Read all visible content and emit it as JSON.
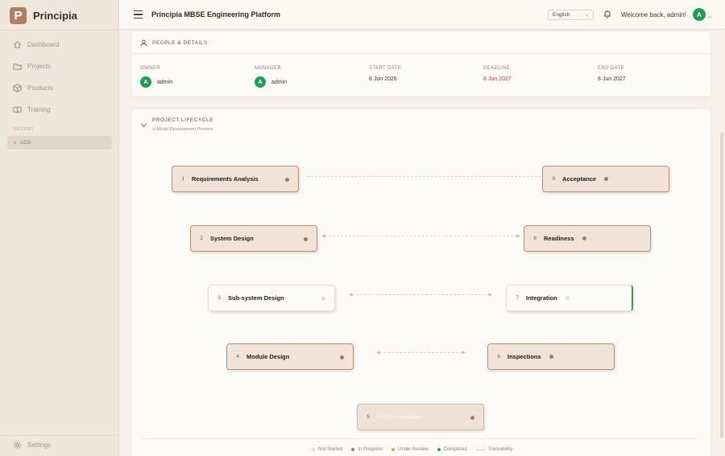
{
  "brand": {
    "logo_letter": "P",
    "name": "Principia"
  },
  "sidebar": {
    "items": [
      {
        "label": "Dashboard",
        "icon": "home-icon"
      },
      {
        "label": "Projects",
        "icon": "folder-icon"
      },
      {
        "label": "Products",
        "icon": "box-icon"
      },
      {
        "label": "Training",
        "icon": "book-icon"
      }
    ],
    "recent_label": "RECENT",
    "recent_items": [
      "ADS"
    ],
    "settings_label": "Settings"
  },
  "header": {
    "title": "Principia MBSE Engineering Platform",
    "language": "English",
    "welcome": "Welcome back, admin!",
    "avatar_letter": "A"
  },
  "people": {
    "title": "PEOPLE & DETAILS",
    "fields": [
      {
        "label": "OWNER",
        "value": "admin",
        "avatar": "A"
      },
      {
        "label": "MANAGER",
        "value": "admin",
        "avatar": "A"
      },
      {
        "label": "START DATE",
        "value": "8 Jun 2026"
      },
      {
        "label": "DEADLINE",
        "value": "8 Jun 2027",
        "color": "#b8432e"
      },
      {
        "label": "END DATE",
        "value": "8 Jun 2027"
      }
    ]
  },
  "lifecycle": {
    "title": "PROJECT LIFECYCLE",
    "subtitle": "V-Model Development Process",
    "nodes": [
      {
        "num": "1",
        "label": "Requirements Analysis"
      },
      {
        "num": "2",
        "label": "System Design"
      },
      {
        "num": "3",
        "label": "Sub-system Design"
      },
      {
        "num": "4",
        "label": "Module Design"
      },
      {
        "num": "5",
        "label": "Implementation"
      },
      {
        "num": "6",
        "label": "Inspections"
      },
      {
        "num": "7",
        "label": "Integration"
      },
      {
        "num": "8",
        "label": "Readiness"
      },
      {
        "num": "9",
        "label": "Acceptance"
      }
    ],
    "legend": [
      "Not Started",
      "In Progress",
      "Under Review",
      "Completed",
      "Traceability"
    ]
  },
  "colors": {
    "accent": "#b07f5f",
    "avatar_green": "#1f9d55",
    "deadline_red": "#b8432e",
    "not_started": "#e4ddd6",
    "in_progress": "#a57b60",
    "under_review": "#d9a441",
    "completed": "#3f9a5a"
  }
}
